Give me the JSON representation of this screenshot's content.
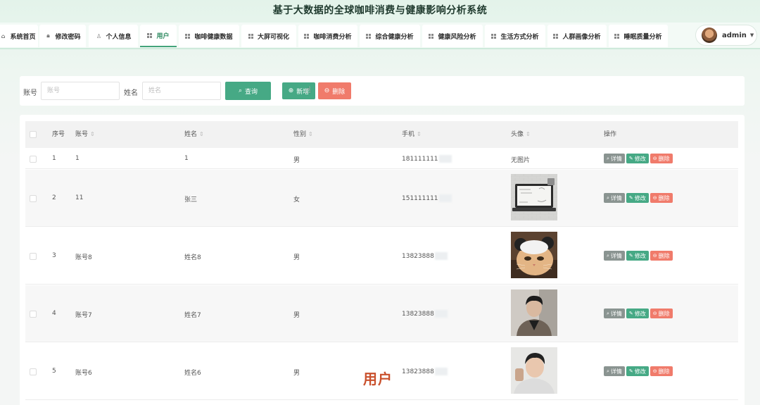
{
  "app": {
    "title": "基于大数据的全球咖啡消费与健康影响分析系统"
  },
  "nav": {
    "items": [
      {
        "label": "系统首页",
        "icon": "home-icon"
      },
      {
        "label": "修改密码",
        "icon": "lock-icon"
      },
      {
        "label": "个人信息",
        "icon": "person-icon"
      },
      {
        "label": "用户",
        "icon": "grid-icon",
        "active": true
      },
      {
        "label": "咖啡健康数据",
        "icon": "grid-icon"
      },
      {
        "label": "大屏可视化",
        "icon": "grid-icon"
      },
      {
        "label": "咖啡消费分析",
        "icon": "grid-icon"
      },
      {
        "label": "综合健康分析",
        "icon": "grid-icon"
      },
      {
        "label": "健康风险分析",
        "icon": "grid-icon"
      },
      {
        "label": "生活方式分析",
        "icon": "grid-icon"
      },
      {
        "label": "人群画像分析",
        "icon": "grid-icon"
      },
      {
        "label": "睡眠质量分析",
        "icon": "grid-icon"
      }
    ],
    "user": {
      "name": "admin"
    }
  },
  "search": {
    "account_label": "账号",
    "account_placeholder": "账号",
    "name_label": "姓名",
    "name_placeholder": "姓名",
    "query_label": "查询",
    "add_label": "新增",
    "delete_label": "删除"
  },
  "table": {
    "headers": {
      "index": "序号",
      "account": "账号",
      "name": "姓名",
      "gender": "性别",
      "phone": "手机",
      "avatar": "头像",
      "actions": "操作"
    },
    "actions": {
      "detail": "详情",
      "edit": "修改",
      "delete": "删除"
    },
    "no_image": "无图片",
    "rows": [
      {
        "index": "1",
        "account": "1",
        "name": "1",
        "gender": "男",
        "phone": "181111111",
        "avatar": "none"
      },
      {
        "index": "2",
        "account": "11",
        "name": "张三",
        "gender": "女",
        "phone": "151111111",
        "avatar": "study-laptop"
      },
      {
        "index": "3",
        "account": "账号8",
        "name": "姓名8",
        "gender": "男",
        "phone": "13823888",
        "avatar": "cat-photo"
      },
      {
        "index": "4",
        "account": "账号7",
        "name": "姓名7",
        "gender": "男",
        "phone": "13823888",
        "avatar": "man-portrait"
      },
      {
        "index": "5",
        "account": "账号6",
        "name": "姓名6",
        "gender": "男",
        "phone": "13823888",
        "avatar": "man-selfie"
      }
    ]
  },
  "caption": "用户",
  "colors": {
    "primary": "#46a985",
    "danger": "#f07b6b",
    "neutral": "#8a9491"
  }
}
